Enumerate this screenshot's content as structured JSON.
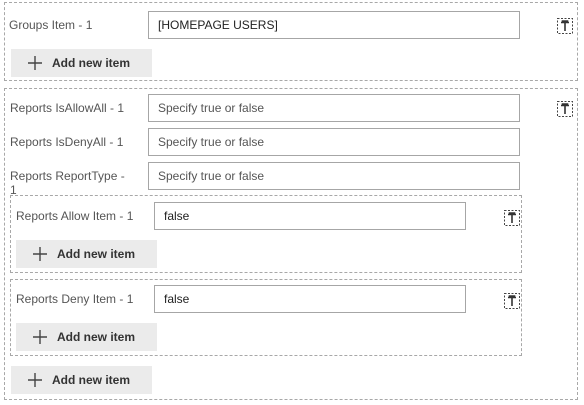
{
  "groups": {
    "label": "Groups Item - 1",
    "value": "[HOMEPAGE USERS]",
    "add_label": "Add new item",
    "delete_icon": "delete-icon"
  },
  "reports": {
    "is_allow_all_label": "Reports IsAllowAll - 1",
    "is_allow_all_placeholder": "Specify true or false",
    "is_deny_all_label": "Reports IsDenyAll - 1",
    "is_deny_all_placeholder": "Specify true or false",
    "report_type_label": "Reports ReportType - 1",
    "report_type_placeholder": "Specify true or false",
    "allow": {
      "label": "Reports Allow Item - 1",
      "value": "false",
      "add_label": "Add new item"
    },
    "deny": {
      "label": "Reports Deny Item - 1",
      "value": "false",
      "add_label": "Add new item"
    },
    "add_label": "Add new item",
    "delete_icon": "delete-icon"
  },
  "icons": {
    "add": "plus-icon",
    "delete": "delete-icon"
  }
}
